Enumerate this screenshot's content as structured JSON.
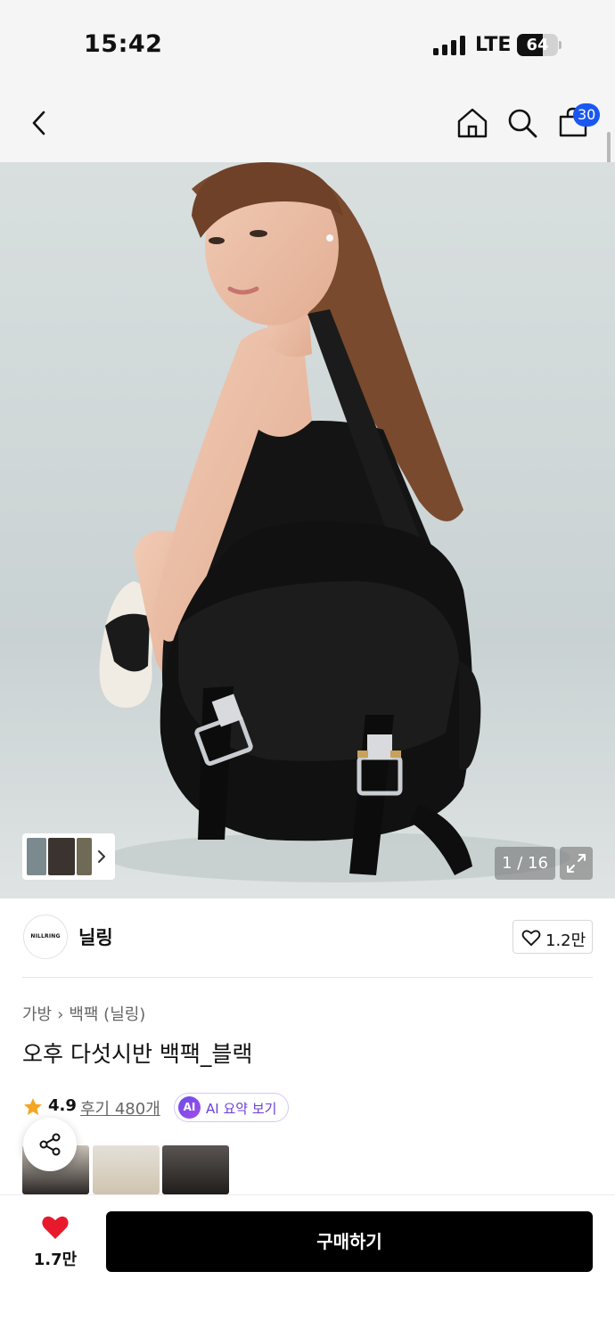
{
  "status_bar": {
    "time": "15:42",
    "network": "LTE",
    "battery": "64"
  },
  "nav": {
    "back_icon": "chevron-left-icon",
    "home_icon": "home-icon",
    "search_icon": "search-icon",
    "cart_icon": "shopping-bag-icon",
    "cart_count": "30"
  },
  "gallery": {
    "counter": "1 / 16",
    "expand_icon": "expand-icon"
  },
  "brand": {
    "logo_text": "NILLRING",
    "name": "닐링",
    "like_count": "1.2만"
  },
  "product": {
    "breadcrumb": [
      "가방",
      "백팩 (닐링)"
    ],
    "title": "오후 다섯시반 백팩_블랙",
    "rating": "4.9",
    "review_link": "후기 480개",
    "ai_badge": "AI",
    "ai_summary_label": "AI 요약 보기"
  },
  "bottom_bar": {
    "like_count": "1.7만",
    "buy_label": "구매하기"
  },
  "colors": {
    "accent": "#1a57f2",
    "heart": "#e8192c",
    "star": "#f5a623",
    "ai": "#6a3fd8"
  }
}
